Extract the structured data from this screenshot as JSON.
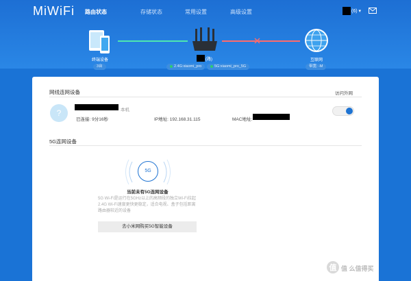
{
  "app": {
    "logo": "MiWiFi"
  },
  "nav": {
    "items": [
      "路由状态",
      "存储状态",
      "常用设置",
      "高级设置"
    ],
    "active_index": 0
  },
  "header": {
    "user_suffix": "(6) ▾"
  },
  "topology": {
    "devices_label": "终端设备",
    "devices_count": "3台",
    "router_name_suffix": "(路)",
    "ssid_24": "2.4G:xiaomi_pro",
    "ssid_5": "5G:xiaomi_pro_5G",
    "internet_label": "互联网",
    "internet_speed": "带宽: -M",
    "colors": {
      "wired_line": "#4ee7b0",
      "internet_line": "#ff6b6b"
    }
  },
  "wireless_section": {
    "title": "网线连网设备",
    "access_header": "访问外网",
    "device": {
      "suffix": "本机",
      "connected_time": "已连接: 9分16秒",
      "ip": "IP地址: 192.168.31.115",
      "mac_label": "MAC地址:",
      "internet_access": true
    }
  },
  "fivegee_section": {
    "title": "5G连网设备",
    "icon_text": "5G",
    "empty_title": "当前未有5G连网设备",
    "description": "5G Wi-Fi是运行在5GHz以上的高频段的独立Wi-Fi拉起2.4G Wi-Fi速度更快更稳定，适合电视、盒子包括距离路由器较近的设备",
    "button": "去小米网购买5G智能设备"
  },
  "watermark": {
    "text": "值 么值得买"
  }
}
